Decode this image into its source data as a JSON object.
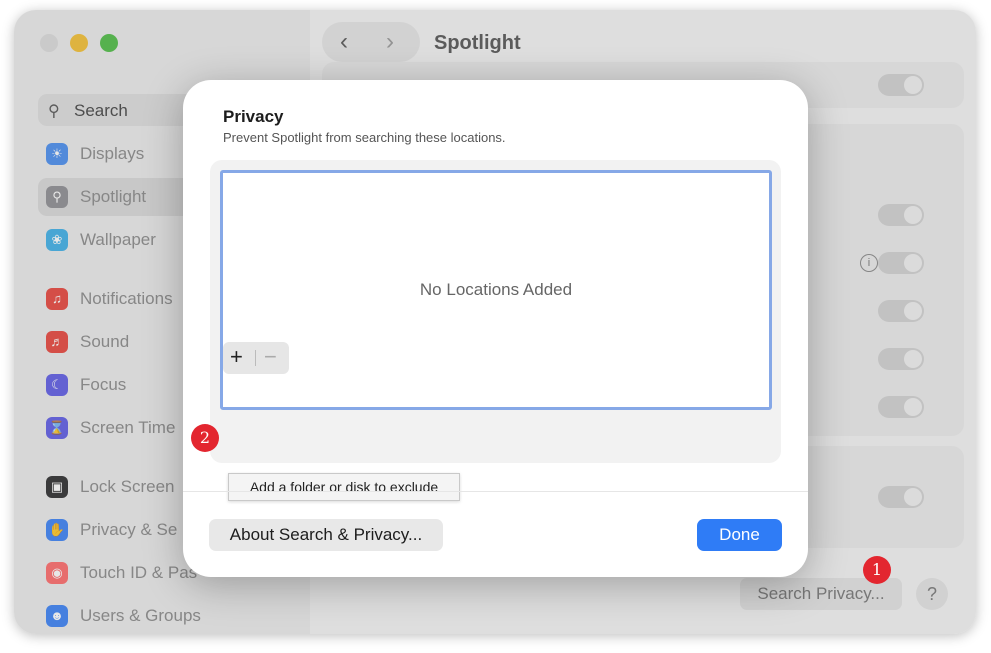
{
  "sidebar": {
    "search_placeholder": "Search",
    "items": [
      {
        "label": "Displays",
        "icon": "sun-icon",
        "color": "#4a8ef0",
        "selected": false
      },
      {
        "label": "Spotlight",
        "icon": "magnifier-icon",
        "color": "#8e8e93",
        "selected": true
      },
      {
        "label": "Wallpaper",
        "icon": "flower-icon",
        "color": "#3fb0e8",
        "selected": false
      },
      {
        "label": "Notifications",
        "icon": "bell-icon",
        "color": "#e8453c",
        "selected": false
      },
      {
        "label": "Sound",
        "icon": "speaker-icon",
        "color": "#e8453c",
        "selected": false
      },
      {
        "label": "Focus",
        "icon": "moon-icon",
        "color": "#5e5ce6",
        "selected": false
      },
      {
        "label": "Screen Time",
        "icon": "hourglass-icon",
        "color": "#5e5ce6",
        "selected": false
      },
      {
        "label": "Lock Screen",
        "icon": "lock-icon",
        "color": "#2c2c2e",
        "selected": false
      },
      {
        "label": "Privacy & Se",
        "icon": "hand-icon",
        "color": "#3b82f6",
        "selected": false
      },
      {
        "label": "Touch ID & Pas",
        "icon": "fingerprint-icon",
        "color": "#ff6b6b",
        "selected": false
      },
      {
        "label": "Users & Groups",
        "icon": "users-icon",
        "color": "#3b82f6",
        "selected": false
      }
    ]
  },
  "main": {
    "title": "Spotlight",
    "back_glyph": "‹",
    "forward_glyph": "›",
    "info_glyph": "i",
    "search_privacy_label": "Search Privacy...",
    "help_label": "?"
  },
  "dialog": {
    "title": "Privacy",
    "subtitle": "Prevent Spotlight from searching these locations.",
    "empty_text": "No Locations Added",
    "add_glyph": "+",
    "remove_glyph": "−",
    "tooltip": "Add a folder or disk to exclude",
    "about_label": "About Search & Privacy...",
    "done_label": "Done"
  },
  "markers": {
    "first": "1",
    "second": "2"
  },
  "colors": {
    "accent": "#2f7cf6",
    "marker": "#e3262f",
    "list_border": "#86a8e7"
  }
}
